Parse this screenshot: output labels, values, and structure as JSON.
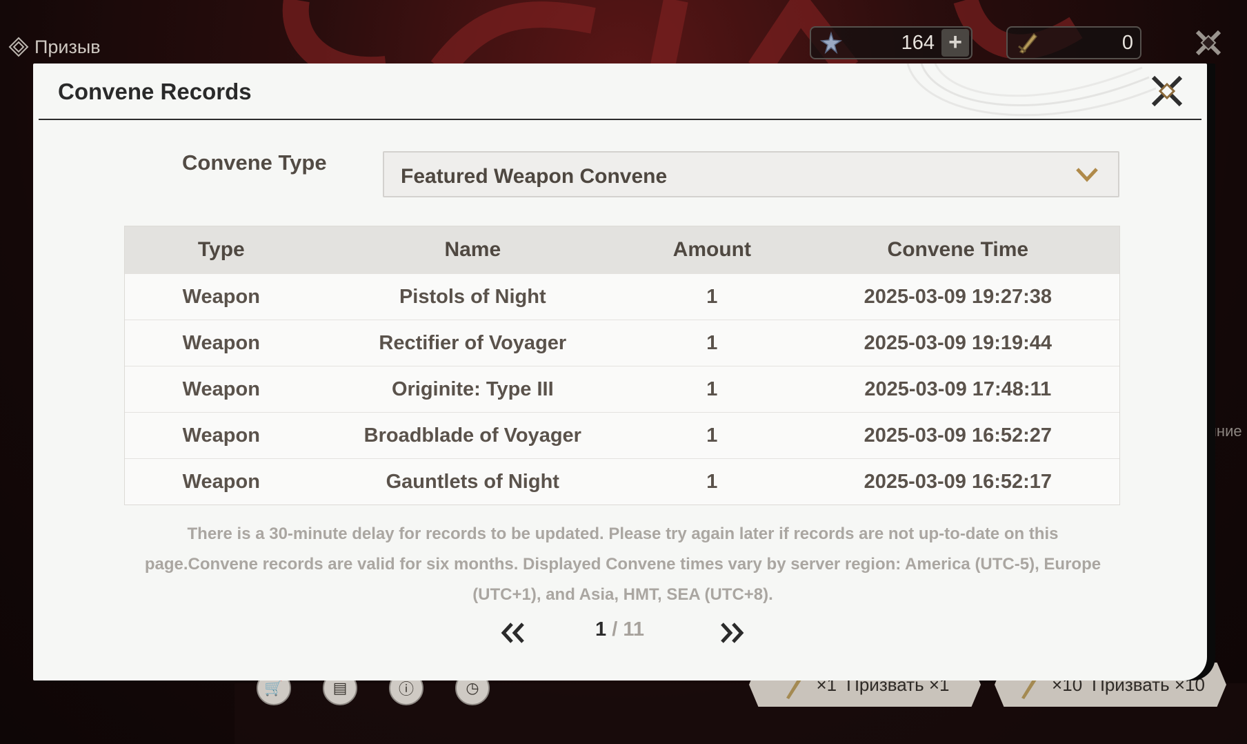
{
  "game": {
    "section_title": "Призыв",
    "currencies": [
      {
        "icon": "astrite-star-icon",
        "value": "164",
        "has_plus": true,
        "plus_label": "+"
      },
      {
        "icon": "forging-tide-icon",
        "value": "0",
        "has_plus": false
      }
    ],
    "bottom_buttons": [
      "cart-icon",
      "records-search-icon",
      "info-icon",
      "history-clock-icon"
    ],
    "summon_x1": {
      "cost": "×1",
      "label": "Призвать ×1"
    },
    "summon_x10": {
      "cost": "×10",
      "label": "Призвать ×10"
    },
    "side_text": "яние"
  },
  "modal": {
    "title": "Convene Records",
    "type_label": "Convene Type",
    "selected_type": "Featured Weapon Convene",
    "columns": [
      "Type",
      "Name",
      "Amount",
      "Convene Time"
    ],
    "rows": [
      {
        "type": "Weapon",
        "name": "Pistols of Night",
        "amount": "1",
        "time": "2025-03-09 19:27:38"
      },
      {
        "type": "Weapon",
        "name": "Rectifier of Voyager",
        "amount": "1",
        "time": "2025-03-09 19:19:44"
      },
      {
        "type": "Weapon",
        "name": "Originite: Type III",
        "amount": "1",
        "time": "2025-03-09 17:48:11"
      },
      {
        "type": "Weapon",
        "name": "Broadblade of Voyager",
        "amount": "1",
        "time": "2025-03-09 16:52:27"
      },
      {
        "type": "Weapon",
        "name": "Gauntlets of Night",
        "amount": "1",
        "time": "2025-03-09 16:52:17"
      }
    ],
    "notice": "There is a 30-minute delay for records to be updated. Please try again later if records are not up-to-date on this page.Convene records are valid for six months. Displayed Convene times vary by server region: America (UTC-5), Europe (UTC+1), and Asia, HMT, SEA (UTC+8).",
    "pagination": {
      "current": "1",
      "separator": "/",
      "total": "11"
    }
  },
  "colors": {
    "accent_gold": "#b08a4a",
    "modal_bg": "#f6f7f5",
    "header_rule": "#2b2b2b",
    "table_head": "#e3e2df"
  }
}
